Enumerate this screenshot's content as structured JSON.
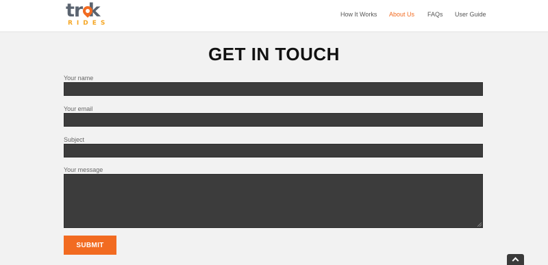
{
  "brand": {
    "logo_word": "tr k",
    "logo_sub": "RIDES",
    "accent_color": "#f26b21",
    "logo_sub_color": "#f5a623"
  },
  "nav": {
    "items": [
      {
        "label": "How It Works",
        "active": false
      },
      {
        "label": "About Us",
        "active": true
      },
      {
        "label": "FAQs",
        "active": false
      },
      {
        "label": "User Guide",
        "active": false
      }
    ]
  },
  "form": {
    "title": "GET IN TOUCH",
    "name_label": "Your name",
    "name_value": "",
    "email_label": "Your email",
    "email_value": "",
    "subject_label": "Subject",
    "subject_value": "",
    "message_label": "Your message",
    "message_value": "",
    "submit_label": "SUBMIT",
    "field_color": "#3c3c3c"
  },
  "scroll_top_icon": "chevron-up-icon"
}
